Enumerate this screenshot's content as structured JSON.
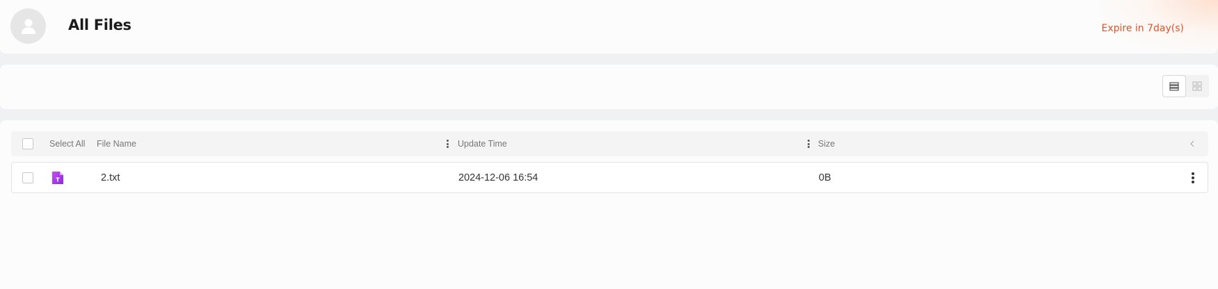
{
  "header": {
    "title": "All Files",
    "expire_text": "Expire in 7day(s)",
    "avatar_icon": "user-icon"
  },
  "toolbar": {
    "view_modes": [
      {
        "icon": "list-view-icon",
        "active": true
      },
      {
        "icon": "grid-view-icon",
        "active": false
      }
    ]
  },
  "table": {
    "select_all_label": "Select All",
    "columns": {
      "name": "File Name",
      "update_time": "Update Time",
      "size": "Size"
    },
    "collapse_icon": "chevron-left-icon",
    "rows": [
      {
        "icon": "text-file-icon",
        "icon_letter": "T",
        "name": "2.txt",
        "update_time": "2024-12-06 16:54",
        "size": "0B"
      }
    ]
  },
  "colors": {
    "accent_orange": "#e2522b",
    "file_icon_purple": "#a434e0",
    "page_background": "#f0f1f3"
  }
}
